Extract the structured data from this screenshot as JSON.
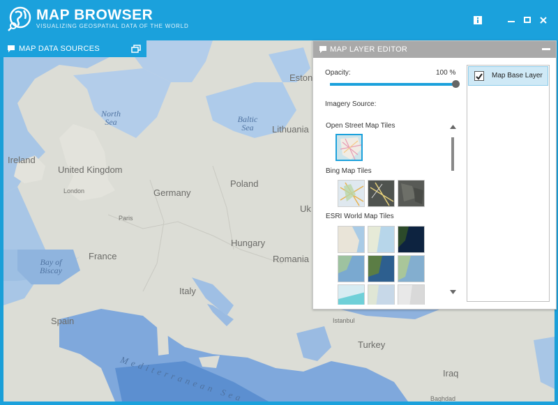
{
  "app": {
    "title": "MAP BROWSER",
    "subtitle": "VISUALIZING GEOSPATIAL DATA OF THE WORLD"
  },
  "window_controls": [
    "info-icon",
    "minimize-icon",
    "maximize-icon",
    "close-icon"
  ],
  "data_sources_panel": {
    "title": "MAP DATA SOURCES"
  },
  "layer_editor": {
    "title": "MAP LAYER EDITOR",
    "opacity_label": "Opacity:",
    "opacity_value_text": "100 %",
    "opacity_value": 100,
    "imagery_source_label": "Imagery Source:",
    "groups": [
      {
        "label": "Open Street Map Tiles",
        "tiles": 1
      },
      {
        "label": "Bing Map Tiles",
        "tiles": 3
      },
      {
        "label": "ESRI World Map Tiles",
        "tiles": 9
      }
    ],
    "layers": [
      {
        "label": "Map Base Layer",
        "checked": true
      }
    ]
  },
  "map": {
    "countries": [
      "Ireland",
      "United Kingdom",
      "Germany",
      "Poland",
      "France",
      "Hungary",
      "Romania",
      "Italy",
      "Spain",
      "Turkey",
      "Lithuania",
      "Estonia",
      "Iraq",
      "Uk"
    ],
    "cities": [
      "London",
      "Paris",
      "Istanbul",
      "Baghdad"
    ],
    "seas": [
      "North Sea",
      "Baltic Sea",
      "Bay of Biscay",
      "Mediterranean Sea"
    ]
  },
  "colors": {
    "accent": "#1ba1dc",
    "land": "#dcddd6",
    "sea": "#a8c6e6",
    "deep_sea": "#6f9fd3"
  }
}
